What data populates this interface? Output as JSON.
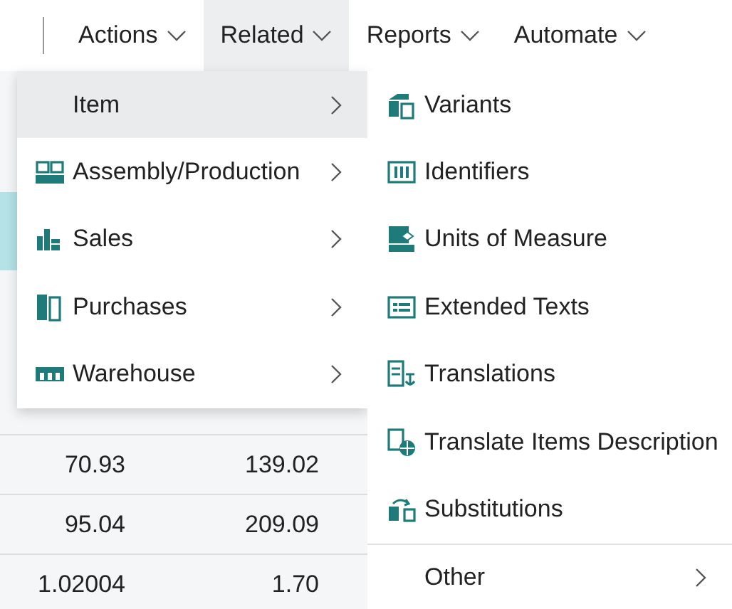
{
  "menu_bar": [
    {
      "label": "Actions",
      "selected": false
    },
    {
      "label": "Related",
      "selected": true
    },
    {
      "label": "Reports",
      "selected": false
    },
    {
      "label": "Automate",
      "selected": false
    }
  ],
  "related_menu": [
    {
      "label": "Item",
      "selected": true
    },
    {
      "label": "Assembly/Production",
      "selected": false
    },
    {
      "label": "Sales",
      "selected": false
    },
    {
      "label": "Purchases",
      "selected": false
    },
    {
      "label": "Warehouse",
      "selected": false
    }
  ],
  "item_submenu": {
    "items": [
      {
        "label": "Variants"
      },
      {
        "label": "Identifiers"
      },
      {
        "label": "Units of Measure"
      },
      {
        "label": "Extended Texts"
      },
      {
        "label": "Translations"
      },
      {
        "label": "Translate Items Description"
      },
      {
        "label": "Substitutions"
      }
    ],
    "other": {
      "label": "Other"
    }
  },
  "table": {
    "rows": [
      {
        "cells": [
          "70.93",
          "139.02"
        ]
      },
      {
        "cells": [
          "95.04",
          "209.09"
        ]
      },
      {
        "cells": [
          "1.02004",
          "1.70"
        ]
      }
    ]
  }
}
